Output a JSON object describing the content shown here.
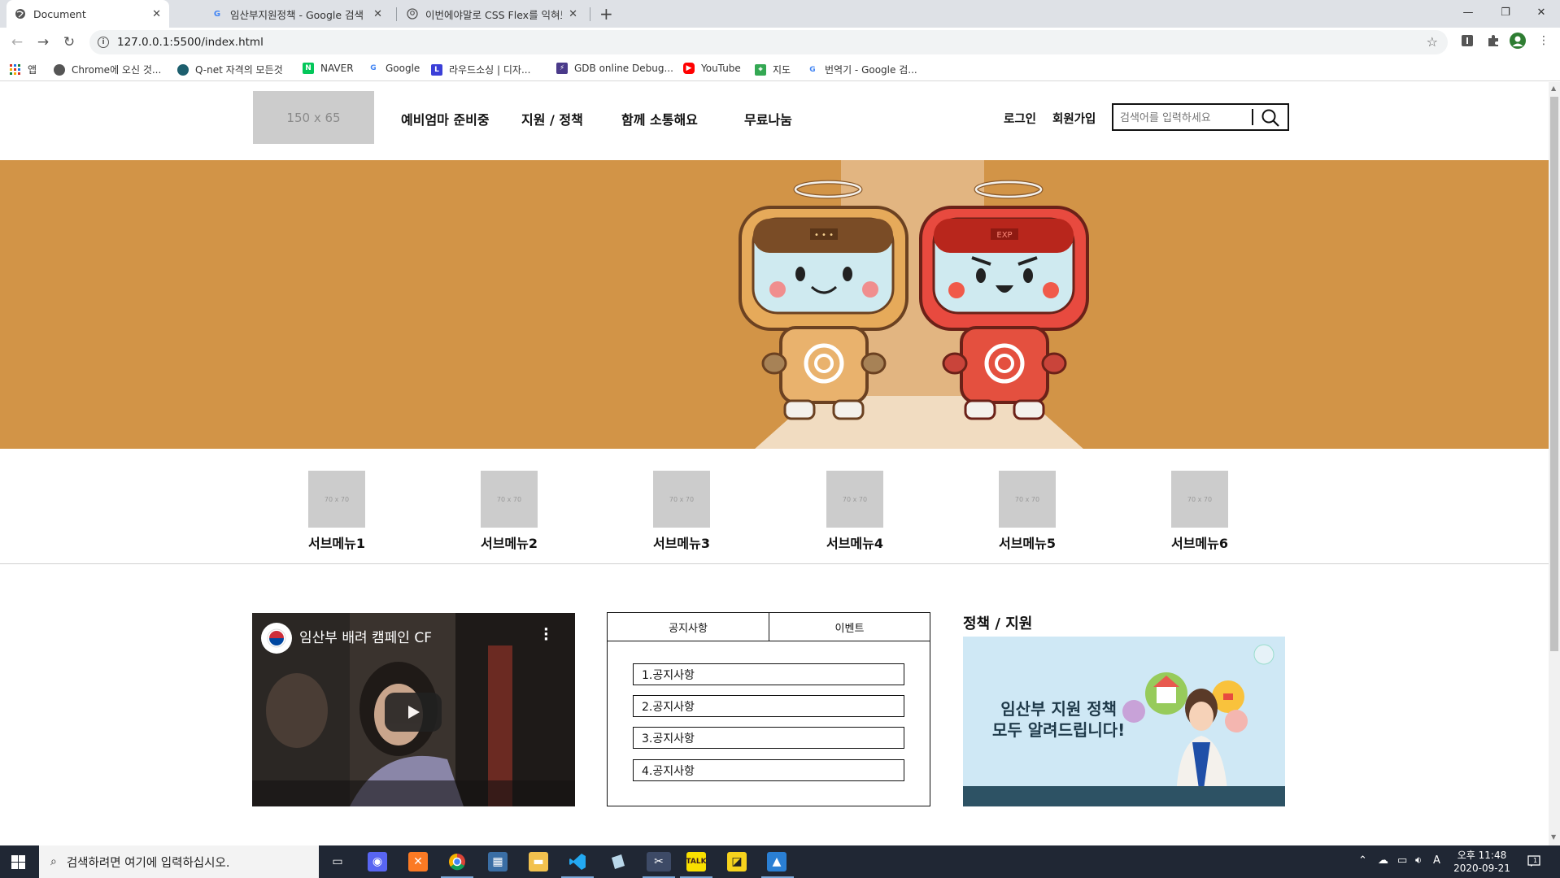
{
  "browser": {
    "tabs": [
      {
        "title": "Document",
        "active": true
      },
      {
        "title": "임산부지원정책 - Google 검색",
        "active": false
      },
      {
        "title": "이번에야말로 CSS Flex를 익혀보자",
        "active": false
      }
    ],
    "new_tab": "+",
    "address": "127.0.0.1:5500/index.html",
    "bookmarks": [
      {
        "label": "앱",
        "icon": "apps-grid-icon"
      },
      {
        "label": "Chrome에 오신 것...",
        "icon": "chrome-icon"
      },
      {
        "label": "Q-net 자격의 모든것",
        "icon": "qnet-icon"
      },
      {
        "label": "NAVER",
        "icon": "naver-icon"
      },
      {
        "label": "Google",
        "icon": "google-icon"
      },
      {
        "label": "라우드소싱 | 디자...",
        "icon": "loud-icon"
      },
      {
        "label": "GDB online Debug...",
        "icon": "gdb-icon"
      },
      {
        "label": "YouTube",
        "icon": "youtube-icon"
      },
      {
        "label": "지도",
        "icon": "maps-icon"
      },
      {
        "label": "번역기 - Google 검...",
        "icon": "google-icon"
      }
    ]
  },
  "header": {
    "logo": "150 x 65",
    "nav": [
      "예비엄마 준비중",
      "지원 / 정책",
      "함께 소통해요",
      "무료나눔"
    ],
    "login": "로그인",
    "signup": "회원가입",
    "search_placeholder": "검색어를 입력하세요"
  },
  "submenu": [
    {
      "thumb": "70 x 70",
      "label": "서브메뉴1"
    },
    {
      "thumb": "70 x 70",
      "label": "서브메뉴2"
    },
    {
      "thumb": "70 x 70",
      "label": "서브메뉴3"
    },
    {
      "thumb": "70 x 70",
      "label": "서브메뉴4"
    },
    {
      "thumb": "70 x 70",
      "label": "서브메뉴5"
    },
    {
      "thumb": "70 x 70",
      "label": "서브메뉴6"
    }
  ],
  "video": {
    "title": "임산부 배려 캠페인 CF"
  },
  "board": {
    "tabs": [
      "공지사항",
      "이벤트"
    ],
    "items": [
      "1.공지사항",
      "2.공지사항",
      "3.공지사항",
      "4.공지사항"
    ]
  },
  "policy": {
    "title": "정책 / 지원",
    "banner_line1": "임산부 지원 정책",
    "banner_line2": "모두 알려드립니다!"
  },
  "taskbar": {
    "search_placeholder": "검색하려면 여기에 입력하십시오.",
    "time": "오후 11:48",
    "date": "2020-09-21",
    "ime": "A",
    "notifications": "1"
  },
  "colors": {
    "banner_bg": "#d29447",
    "placeholder_gray": "#cccccc",
    "taskbar_bg": "#202734"
  }
}
